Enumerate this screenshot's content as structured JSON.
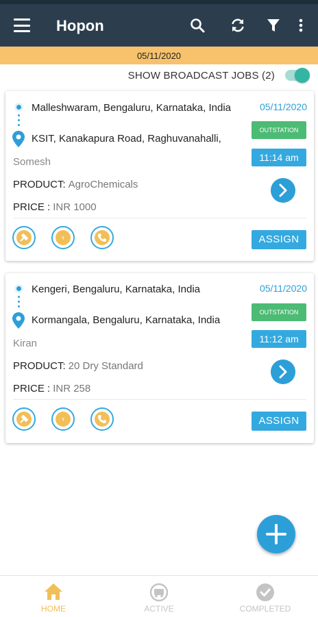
{
  "app": {
    "title": "Hopon"
  },
  "date_banner": "05/11/2020",
  "broadcast": {
    "label": "SHOW BROADCAST JOBS (2)",
    "enabled": true
  },
  "jobs": [
    {
      "pickup": "Malleshwaram, Bengaluru, Karnataka, India",
      "drop": "KSIT, Kanakapura Road, Raghuvanahalli,",
      "customer": "Somesh",
      "product_label": "PRODUCT:",
      "product": "AgroChemicals",
      "price_label": "PRICE :",
      "price": "INR 1000",
      "date": "05/11/2020",
      "trip_type": "OUTSTATION",
      "time": "11:14 am",
      "assign_label": "ASSIGN"
    },
    {
      "pickup": "Kengeri, Bengaluru, Karnataka, India",
      "drop": "Kormangala, Bengaluru, Karnataka, India",
      "customer": "Kiran",
      "product_label": "PRODUCT:",
      "product": "20 Dry Standard",
      "price_label": "PRICE :",
      "price": "INR 258",
      "date": "05/11/2020",
      "trip_type": "OUTSTATION",
      "time": "11:12 am",
      "assign_label": "ASSIGN"
    }
  ],
  "bottom_nav": [
    {
      "label": "HOME",
      "icon": "home-icon",
      "active": true
    },
    {
      "label": "ACTIVE",
      "icon": "truck-icon",
      "active": false
    },
    {
      "label": "COMPLETED",
      "icon": "check-circle-icon",
      "active": false
    }
  ],
  "colors": {
    "appbar": "#2c3e4e",
    "banner": "#f7c26b",
    "accent": "#2d9fd8",
    "outstation": "#4cbb74",
    "toggle": "#33b5a4",
    "nav_active": "#f1bf58",
    "nav_inactive": "#c4c4c4"
  }
}
